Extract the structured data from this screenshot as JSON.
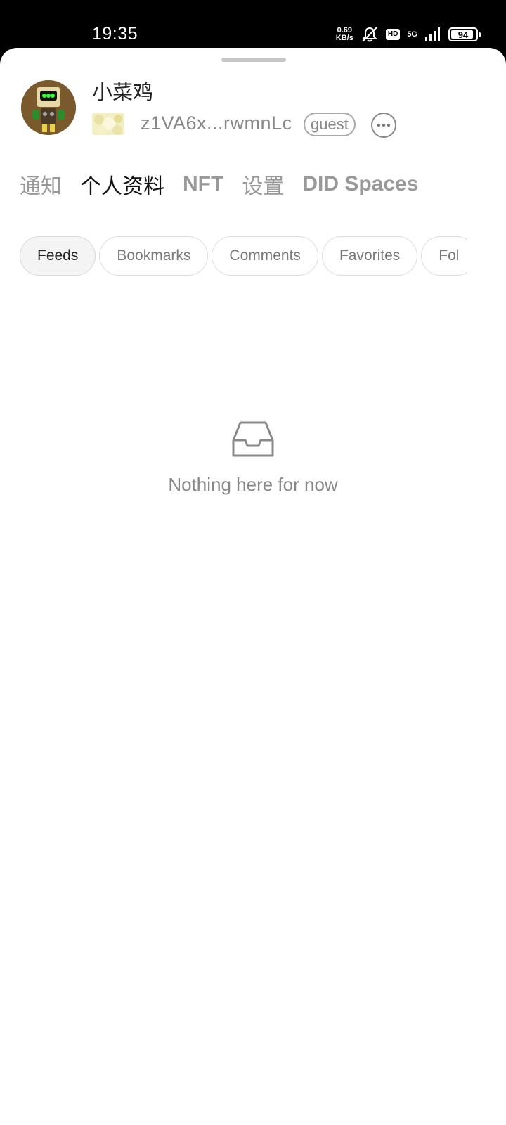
{
  "status_bar": {
    "time": "19:35",
    "net_speed_value": "0.69",
    "net_speed_unit": "KB/s",
    "hd_label": "HD",
    "network_label": "5G",
    "battery_level": "94",
    "icons": [
      "mute-bell-icon",
      "signal-icon",
      "battery-icon"
    ]
  },
  "profile": {
    "username": "小菜鸡",
    "did_address": "z1VA6x...rwmnLc",
    "role": "guest"
  },
  "main_tabs": [
    {
      "label": "通知"
    },
    {
      "label": "个人资料"
    },
    {
      "label": "NFT"
    },
    {
      "label": "设置"
    },
    {
      "label": "DID Spaces"
    }
  ],
  "active_main_tab": "个人资料",
  "sub_tabs": [
    {
      "label": "Feeds"
    },
    {
      "label": "Bookmarks"
    },
    {
      "label": "Comments"
    },
    {
      "label": "Favorites"
    },
    {
      "label": "Fol"
    }
  ],
  "active_sub_tab": "Feeds",
  "empty_state": {
    "icon": "inbox-icon",
    "text": "Nothing here for now"
  }
}
